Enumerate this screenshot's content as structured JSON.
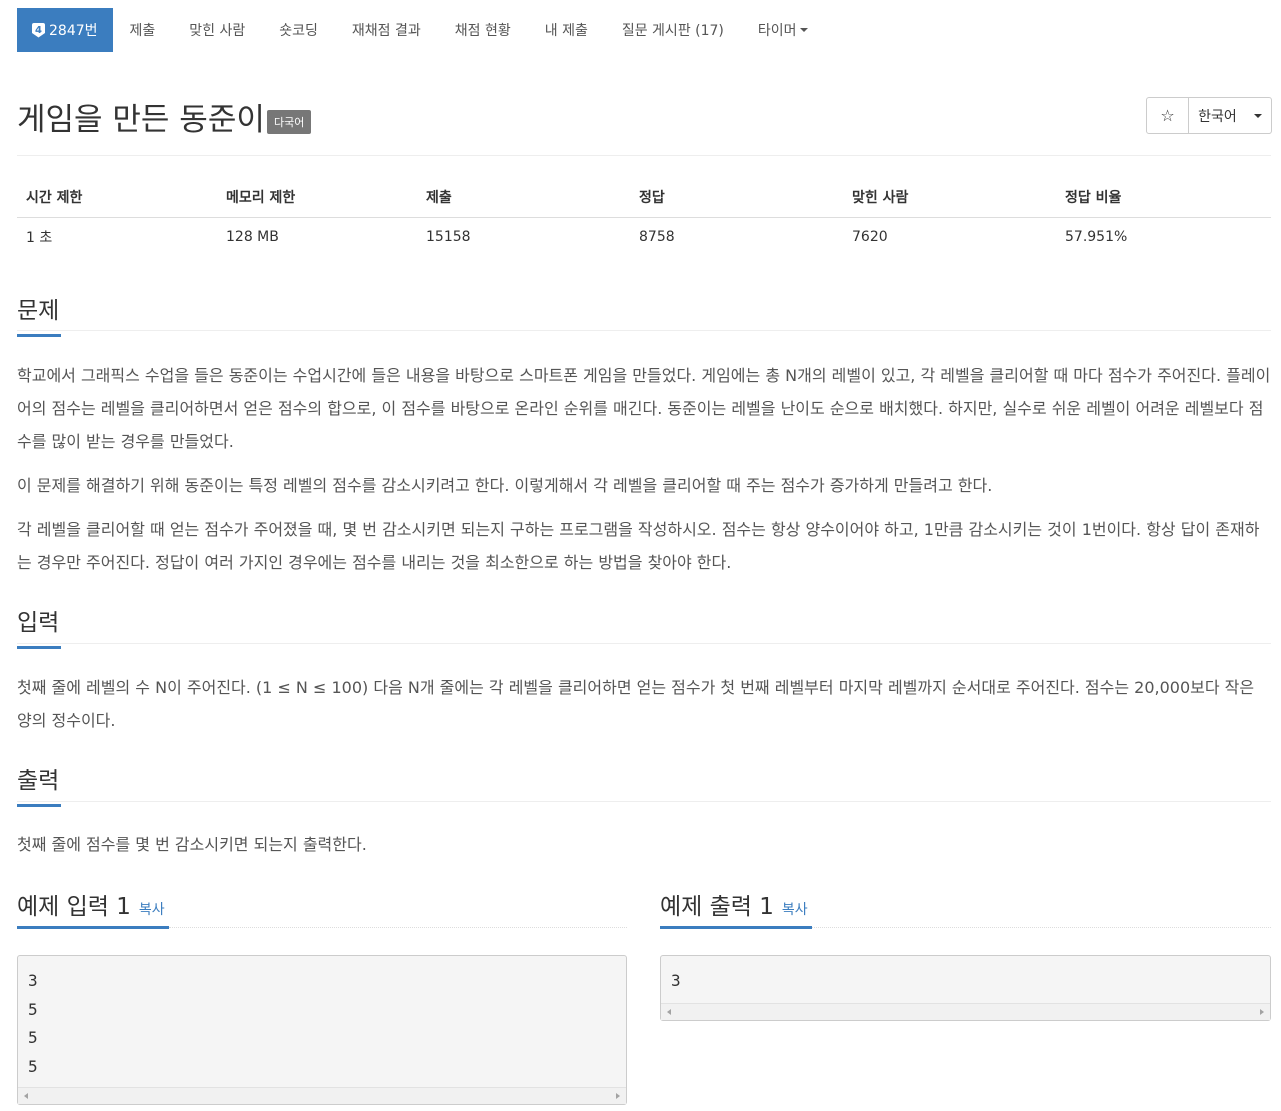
{
  "nav": {
    "problem_tab": {
      "tier_icon": "tier-badge-icon",
      "tier_text": "4",
      "label": "2847번"
    },
    "tabs": [
      {
        "label": "제출",
        "name": "tab-submit"
      },
      {
        "label": "맞힌 사람",
        "name": "tab-solvers"
      },
      {
        "label": "숏코딩",
        "name": "tab-shortcoding"
      },
      {
        "label": "재채점 결과",
        "name": "tab-rejudge"
      },
      {
        "label": "채점 현황",
        "name": "tab-status"
      },
      {
        "label": "내 제출",
        "name": "tab-my-submissions"
      },
      {
        "label": "질문 게시판 (17)",
        "name": "tab-board"
      }
    ],
    "timer_label": "타이머"
  },
  "problem": {
    "title": "게임을 만든 동준이",
    "language_badge": "다국어",
    "star_icon": "☆",
    "language_select": "한국어"
  },
  "info": {
    "headers": [
      "시간 제한",
      "메모리 제한",
      "제출",
      "정답",
      "맞힌 사람",
      "정답 비율"
    ],
    "values": [
      "1 초",
      "128 MB",
      "15158",
      "8758",
      "7620",
      "57.951%"
    ]
  },
  "sections": {
    "description_title": "문제",
    "description": [
      "학교에서 그래픽스 수업을 들은 동준이는 수업시간에 들은 내용을 바탕으로 스마트폰 게임을 만들었다. 게임에는 총 N개의 레벨이 있고, 각 레벨을 클리어할 때 마다 점수가 주어진다. 플레이어의 점수는 레벨을 클리어하면서 얻은 점수의 합으로, 이 점수를 바탕으로 온라인 순위를 매긴다. 동준이는 레벨을 난이도 순으로 배치했다. 하지만, 실수로 쉬운 레벨이 어려운 레벨보다 점수를 많이 받는 경우를 만들었다.",
      "이 문제를 해결하기 위해 동준이는 특정 레벨의 점수를 감소시키려고 한다. 이렇게해서 각 레벨을 클리어할 때 주는 점수가 증가하게 만들려고 한다.",
      "각 레벨을 클리어할 때 얻는 점수가 주어졌을 때, 몇 번 감소시키면 되는지 구하는 프로그램을 작성하시오. 점수는 항상 양수이어야 하고, 1만큼 감소시키는 것이 1번이다. 항상 답이 존재하는 경우만 주어진다. 정답이 여러 가지인 경우에는 점수를 내리는 것을 최소한으로 하는 방법을 찾아야 한다."
    ],
    "input_title": "입력",
    "input": "첫째 줄에 레벨의 수 N이 주어진다. (1 ≤ N ≤ 100) 다음 N개 줄에는 각 레벨을 클리어하면 얻는 점수가 첫 번째 레벨부터 마지막 레벨까지 순서대로 주어진다. 점수는 20,000보다 작은 양의 정수이다.",
    "output_title": "출력",
    "output": "첫째 줄에 점수를 몇 번 감소시키면 되는지 출력한다."
  },
  "samples": {
    "input_title": "예제 입력 1",
    "output_title": "예제 출력 1",
    "copy_label": "복사",
    "input_lines": [
      "3",
      "5",
      "5",
      "5"
    ],
    "output_lines": [
      "3"
    ]
  },
  "colors": {
    "accent": "#3b7dbf",
    "badge": "#777777"
  }
}
